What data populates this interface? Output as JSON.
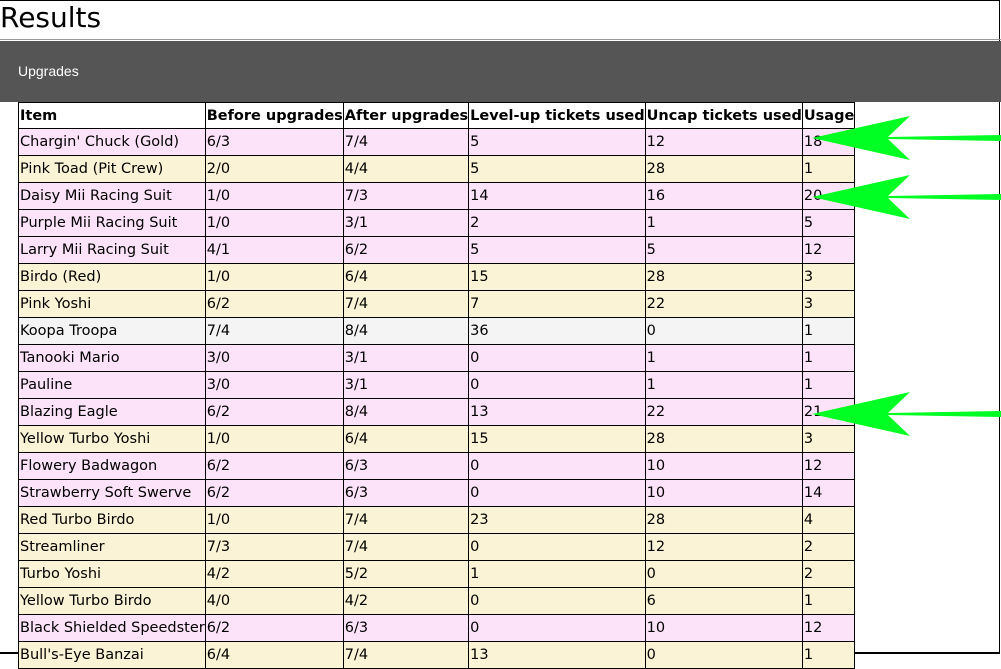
{
  "page": {
    "title": "Results"
  },
  "section": {
    "title": "Upgrades"
  },
  "table": {
    "headers": [
      "Item",
      "Before upgrades",
      "After upgrades",
      "Level-up tickets used",
      "Uncap tickets used",
      "Usage"
    ],
    "rows": [
      {
        "cells": [
          "Chargin' Chuck (Gold)",
          "6/3",
          "7/4",
          "5",
          "12",
          "18"
        ],
        "color": "#fde3fa"
      },
      {
        "cells": [
          "Pink Toad (Pit Crew)",
          "2/0",
          "4/4",
          "5",
          "28",
          "1"
        ],
        "color": "#fbf3d5"
      },
      {
        "cells": [
          "Daisy Mii Racing Suit",
          "1/0",
          "7/3",
          "14",
          "16",
          "20"
        ],
        "color": "#fde3fa"
      },
      {
        "cells": [
          "Purple Mii Racing Suit",
          "1/0",
          "3/1",
          "2",
          "1",
          "5"
        ],
        "color": "#fde3fa"
      },
      {
        "cells": [
          "Larry Mii Racing Suit",
          "4/1",
          "6/2",
          "5",
          "5",
          "12"
        ],
        "color": "#fde3fa"
      },
      {
        "cells": [
          "Birdo (Red)",
          "1/0",
          "6/4",
          "15",
          "28",
          "3"
        ],
        "color": "#fbf3d5"
      },
      {
        "cells": [
          "Pink Yoshi",
          "6/2",
          "7/4",
          "7",
          "22",
          "3"
        ],
        "color": "#fbf3d5"
      },
      {
        "cells": [
          "Koopa Troopa",
          "7/4",
          "8/4",
          "36",
          "0",
          "1"
        ],
        "color": "#f4f4f4"
      },
      {
        "cells": [
          "Tanooki Mario",
          "3/0",
          "3/1",
          "0",
          "1",
          "1"
        ],
        "color": "#fde3fa"
      },
      {
        "cells": [
          "Pauline",
          "3/0",
          "3/1",
          "0",
          "1",
          "1"
        ],
        "color": "#fde3fa"
      },
      {
        "cells": [
          "Blazing Eagle",
          "6/2",
          "8/4",
          "13",
          "22",
          "21"
        ],
        "color": "#fde3fa"
      },
      {
        "cells": [
          "Yellow Turbo Yoshi",
          "1/0",
          "6/4",
          "15",
          "28",
          "3"
        ],
        "color": "#fbf3d5"
      },
      {
        "cells": [
          "Flowery Badwagon",
          "6/2",
          "6/3",
          "0",
          "10",
          "12"
        ],
        "color": "#fde3fa"
      },
      {
        "cells": [
          "Strawberry Soft Swerve",
          "6/2",
          "6/3",
          "0",
          "10",
          "14"
        ],
        "color": "#fde3fa"
      },
      {
        "cells": [
          "Red Turbo Birdo",
          "1/0",
          "7/4",
          "23",
          "28",
          "4"
        ],
        "color": "#fbf3d5"
      },
      {
        "cells": [
          "Streamliner",
          "7/3",
          "7/4",
          "0",
          "12",
          "2"
        ],
        "color": "#fbf3d5"
      },
      {
        "cells": [
          "Turbo Yoshi",
          "4/2",
          "5/2",
          "1",
          "0",
          "2"
        ],
        "color": "#fbf3d5"
      },
      {
        "cells": [
          "Yellow Turbo Birdo",
          "4/0",
          "4/2",
          "0",
          "6",
          "1"
        ],
        "color": "#fbf3d5"
      },
      {
        "cells": [
          "Black Shielded Speedster",
          "6/2",
          "6/3",
          "0",
          "10",
          "12"
        ],
        "color": "#fde3fa"
      },
      {
        "cells": [
          "Bull's-Eye Banzai",
          "6/4",
          "7/4",
          "13",
          "0",
          "1"
        ],
        "color": "#fbf3d5"
      }
    ]
  },
  "annotations": {
    "arrow_color": "#00ff22",
    "arrows": [
      {
        "icon": "left-arrow-icon"
      },
      {
        "icon": "left-arrow-icon"
      },
      {
        "icon": "left-arrow-icon"
      }
    ]
  }
}
